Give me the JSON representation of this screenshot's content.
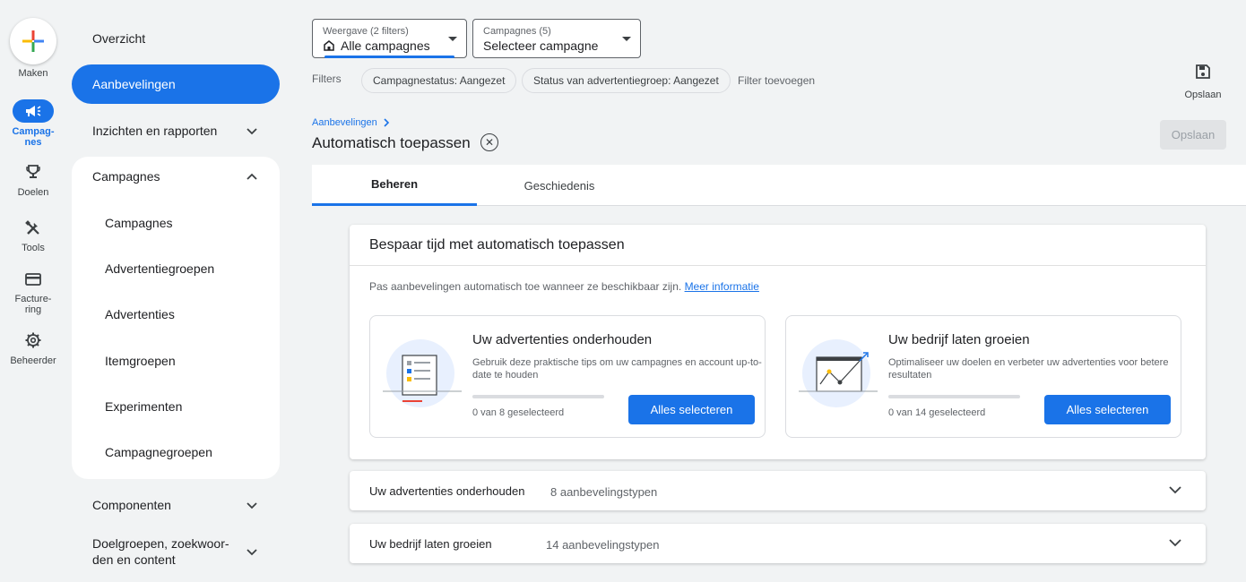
{
  "rail": {
    "create_label": "Maken",
    "items": [
      {
        "label": "Campag-\nnes",
        "icon": "megaphone-icon"
      },
      {
        "label": "Doelen",
        "icon": "trophy-icon"
      },
      {
        "label": "Tools",
        "icon": "tools-icon"
      },
      {
        "label": "Facture-\nring",
        "icon": "credit-card-icon"
      },
      {
        "label": "Beheerder",
        "icon": "gear-icon"
      }
    ]
  },
  "nav": {
    "overview": "Overzicht",
    "recommendations": "Aanbevelingen",
    "insights": "Inzichten en rapporten",
    "campaigns_group": "Campagnes",
    "campaign_sub": [
      "Campagnes",
      "Advertentiegroepen",
      "Advertenties",
      "Itemgroepen",
      "Experimenten",
      "Campagnegroepen"
    ],
    "components": "Componenten",
    "audiences": "Doelgroepen, zoekwoor-\nden en content"
  },
  "topbar": {
    "view_small": "Weergave (2 filters)",
    "view_main": "Alle campagnes",
    "campaigns_small": "Campagnes (5)",
    "campaigns_main": "Selecteer campagne",
    "filters_label": "Filters",
    "chips": [
      "Campagnestatus: Aangezet",
      "Status van advertentiegroep: Aangezet"
    ],
    "add_filter": "Filter toevoegen",
    "save_label": "Opslaan"
  },
  "page": {
    "breadcrumb": "Aanbevelingen",
    "title": "Automatisch toepassen",
    "save_button": "Opslaan"
  },
  "tabs": [
    "Beheren",
    "Geschiedenis"
  ],
  "card": {
    "title": "Bespaar tijd met automatisch toepassen",
    "desc": "Pas aanbevelingen automatisch toe wanneer ze beschikbaar zijn.",
    "link": "Meer informatie",
    "sub_cards": [
      {
        "title": "Uw advertenties onderhouden",
        "desc": "Gebruik deze praktische tips om uw campagnes en account up-to-date te houden",
        "progress_label": "0 van 8 geselecteerd",
        "progress": 0,
        "button": "Alles selecteren"
      },
      {
        "title": "Uw bedrijf laten groeien",
        "desc": "Optimaliseer uw doelen en verbeter uw advertenties voor betere resultaten",
        "progress_label": "0 van 14 geselecteerd",
        "progress": 0,
        "button": "Alles selecteren"
      }
    ]
  },
  "accordions": [
    {
      "title": "Uw advertenties onderhouden",
      "count": "8 aanbevelingstypen"
    },
    {
      "title": "Uw bedrijf laten groeien",
      "count": "14 aanbevelingstypen"
    }
  ],
  "colors": {
    "accent": "#1a73e8",
    "background": "#f1f3f4"
  }
}
